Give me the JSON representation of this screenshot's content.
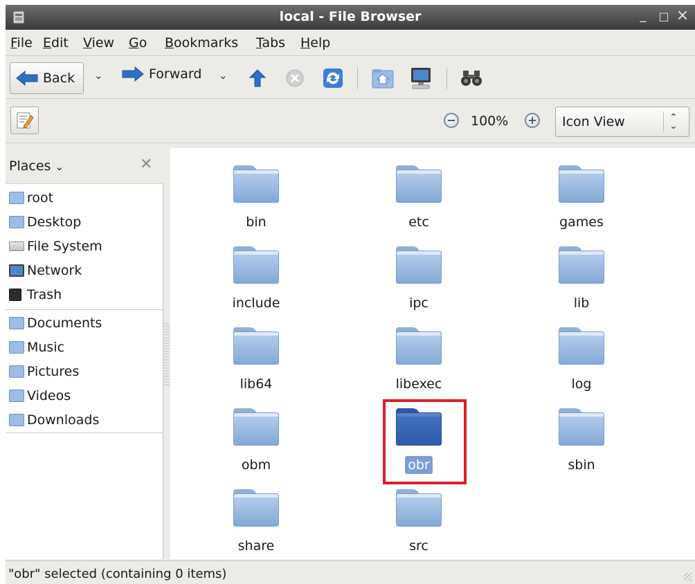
{
  "window": {
    "title": "local - File Browser",
    "controls": {
      "minimize": "_",
      "maximize": "□",
      "close": "×"
    }
  },
  "menu": [
    {
      "mnemonic": "F",
      "rest": "ile"
    },
    {
      "mnemonic": "E",
      "rest": "dit"
    },
    {
      "mnemonic": "V",
      "rest": "iew"
    },
    {
      "mnemonic": "G",
      "rest": "o"
    },
    {
      "mnemonic": "B",
      "rest": "ookmarks"
    },
    {
      "mnemonic": "T",
      "rest": "abs"
    },
    {
      "mnemonic": "H",
      "rest": "elp"
    }
  ],
  "toolbar": {
    "back_label": "Back",
    "forward_label": "Forward",
    "chevron": "⌄",
    "icons": [
      "back-arrow-icon",
      "forward-arrow-icon",
      "up-arrow-icon",
      "stop-icon",
      "reload-icon",
      "home-folder-icon",
      "computer-icon",
      "search-binoculars-icon"
    ]
  },
  "locationbar": {
    "zoom_level": "100%",
    "view_mode": "Icon View",
    "select_arrows": "⌃⌄"
  },
  "sidebar": {
    "header": "Places",
    "header_caret": "⌄",
    "close": "✕",
    "places": [
      {
        "label": "root",
        "icon": "home-folder-icon"
      },
      {
        "label": "Desktop",
        "icon": "desktop-folder-icon"
      },
      {
        "label": "File System",
        "icon": "drive-icon"
      },
      {
        "label": "Network",
        "icon": "network-icon"
      },
      {
        "label": "Trash",
        "icon": "trash-icon"
      }
    ],
    "bookmarks": [
      {
        "label": "Documents",
        "icon": "documents-folder-icon"
      },
      {
        "label": "Music",
        "icon": "music-folder-icon"
      },
      {
        "label": "Pictures",
        "icon": "pictures-folder-icon"
      },
      {
        "label": "Videos",
        "icon": "videos-folder-icon"
      },
      {
        "label": "Downloads",
        "icon": "downloads-folder-icon"
      }
    ]
  },
  "files": [
    {
      "name": "bin"
    },
    {
      "name": "etc"
    },
    {
      "name": "games"
    },
    {
      "name": "include"
    },
    {
      "name": "ipc"
    },
    {
      "name": "lib"
    },
    {
      "name": "lib64"
    },
    {
      "name": "libexec"
    },
    {
      "name": "log"
    },
    {
      "name": "obm"
    },
    {
      "name": "obr",
      "selected": true
    },
    {
      "name": "sbin"
    },
    {
      "name": "share"
    },
    {
      "name": "src"
    }
  ],
  "colors": {
    "folder": "#9dbde6",
    "folder_selected": "#3563b5",
    "selection_text_bg": "#7d9dd3",
    "highlight_box": "#d9202a",
    "titlebar": "#4a4a4a"
  },
  "status": "\"obr\" selected (containing 0 items)"
}
